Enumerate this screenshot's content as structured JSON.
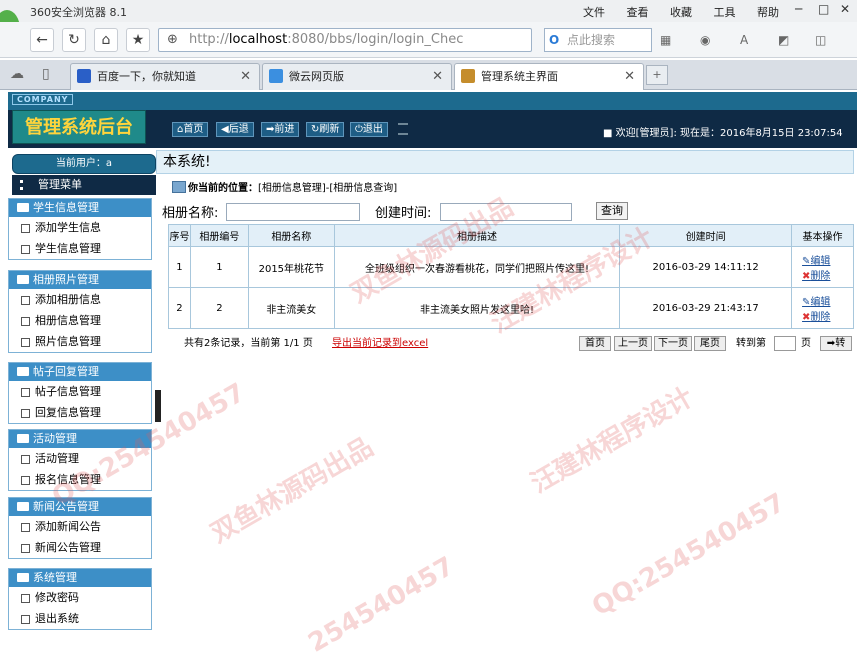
{
  "browser": {
    "title": "360安全浏览器 8.1",
    "menu": [
      "文件",
      "查看",
      "收藏",
      "工具",
      "帮助"
    ],
    "address_host": "localhost",
    "address_prefix": "http://",
    "address_rest": ":8080/bbs/login/login_Chec",
    "search_placeholder": "点此搜索",
    "tabs": [
      {
        "label": "百度一下，你就知道"
      },
      {
        "label": "微云网页版"
      },
      {
        "label": "管理系统主界面"
      }
    ]
  },
  "header": {
    "company": "COMPANY",
    "title": "管理系统后台",
    "buttons": [
      "首页",
      "后退",
      "前进",
      "刷新",
      "退出"
    ],
    "welcome": "欢迎[管理员]:  现在是：2016年8月15日 23:07:54"
  },
  "sidebar": {
    "user_label": "当前用户：a",
    "menu_label": "管理菜单",
    "groups": [
      {
        "title": "学生信息管理",
        "items": [
          "添加学生信息",
          "学生信息管理"
        ]
      },
      {
        "title": "相册照片管理",
        "items": [
          "添加相册信息",
          "相册信息管理",
          "照片信息管理"
        ]
      },
      {
        "title": "帖子回复管理",
        "items": [
          "帖子信息管理",
          "回复信息管理"
        ]
      },
      {
        "title": "活动管理",
        "items": [
          "活动管理",
          "报名信息管理"
        ]
      },
      {
        "title": "新闻公告管理",
        "items": [
          "添加新闻公告",
          "新闻公告管理"
        ]
      },
      {
        "title": "系统管理",
        "items": [
          "修改密码",
          "退出系统"
        ]
      }
    ]
  },
  "content": {
    "heading": "本系统!",
    "position_label": "你当前的位置：",
    "position_path": "[相册信息管理]-[相册信息查询]",
    "search_name_label": "相册名称:",
    "search_time_label": "创建时间:",
    "query_button": "查询",
    "columns": [
      "序号",
      "相册编号",
      "相册名称",
      "相册描述",
      "创建时间",
      "基本操作"
    ],
    "rows": [
      {
        "no": "1",
        "id": "1",
        "name": "2015年桃花节",
        "desc": "全班级组织一次春游看桃花，同学们把照片传这里!",
        "time": "2016-03-29 14:11:12"
      },
      {
        "no": "2",
        "id": "2",
        "name": "非主流美女",
        "desc": "非主流美女照片发这里哈!",
        "time": "2016-03-29 21:43:17"
      }
    ],
    "edit_label": "编辑",
    "delete_label": "删除",
    "summary": "共有2条记录，当前第 1/1 页",
    "export_label": "导出当前记录到excel",
    "pager": [
      "首页",
      "上一页",
      "下一页",
      "尾页"
    ],
    "goto_label": "转到第",
    "page_unit": "页",
    "go_label": "转"
  },
  "watermarks": [
    "QQ:254540457",
    "双鱼林源码出品",
    "汪建林程序设计",
    "QQ:254540457",
    "双鱼林源码出品",
    "汪建林程序设计",
    "254540457"
  ]
}
